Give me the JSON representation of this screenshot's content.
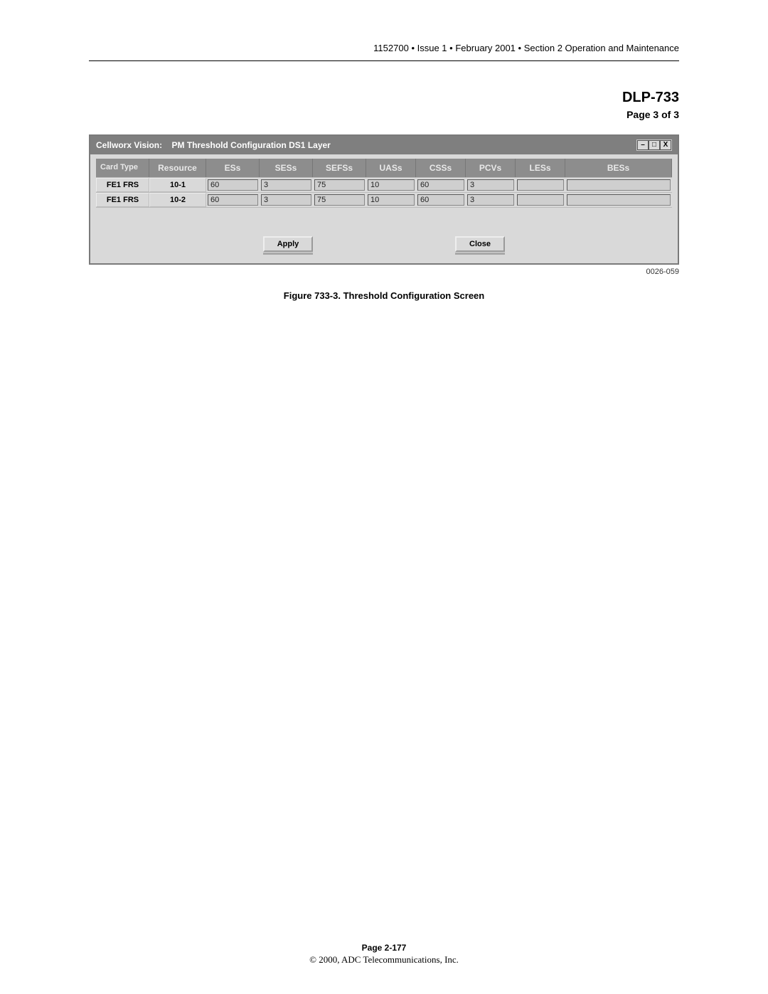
{
  "header": {
    "doc_number": "1152700",
    "bullet": "•",
    "issue": "Issue 1",
    "date": "February 2001",
    "section": "Section 2 Operation and Maintenance"
  },
  "title": {
    "code": "DLP-733",
    "page_of": "Page 3 of 3"
  },
  "window": {
    "title_app": "Cellworx Vision:",
    "title_rest": "PM Threshold Configuration DS1 Layer",
    "min_glyph": "–",
    "max_glyph": "□",
    "close_glyph": "X"
  },
  "columns": [
    "Card Type",
    "Resource",
    "ESs",
    "SESs",
    "SEFSs",
    "UASs",
    "CSSs",
    "PCVs",
    "LESs",
    "BESs"
  ],
  "rows": [
    {
      "card_type": "FE1 FRS",
      "resource": "10-1",
      "ESs": "60",
      "SESs": "3",
      "SEFSs": "75",
      "UASs": "10",
      "CSSs": "60",
      "PCVs": "3",
      "LESs": "",
      "BESs": ""
    },
    {
      "card_type": "FE1 FRS",
      "resource": "10-2",
      "ESs": "60",
      "SESs": "3",
      "SEFSs": "75",
      "UASs": "10",
      "CSSs": "60",
      "PCVs": "3",
      "LESs": "",
      "BESs": ""
    }
  ],
  "buttons": {
    "apply": "Apply",
    "close": "Close"
  },
  "figure_id": "0026-059",
  "figure_caption": "Figure 733-3.  Threshold Configuration Screen",
  "footer": {
    "page": "Page 2-177",
    "copyright": "© 2000, ADC Telecommunications, Inc."
  }
}
